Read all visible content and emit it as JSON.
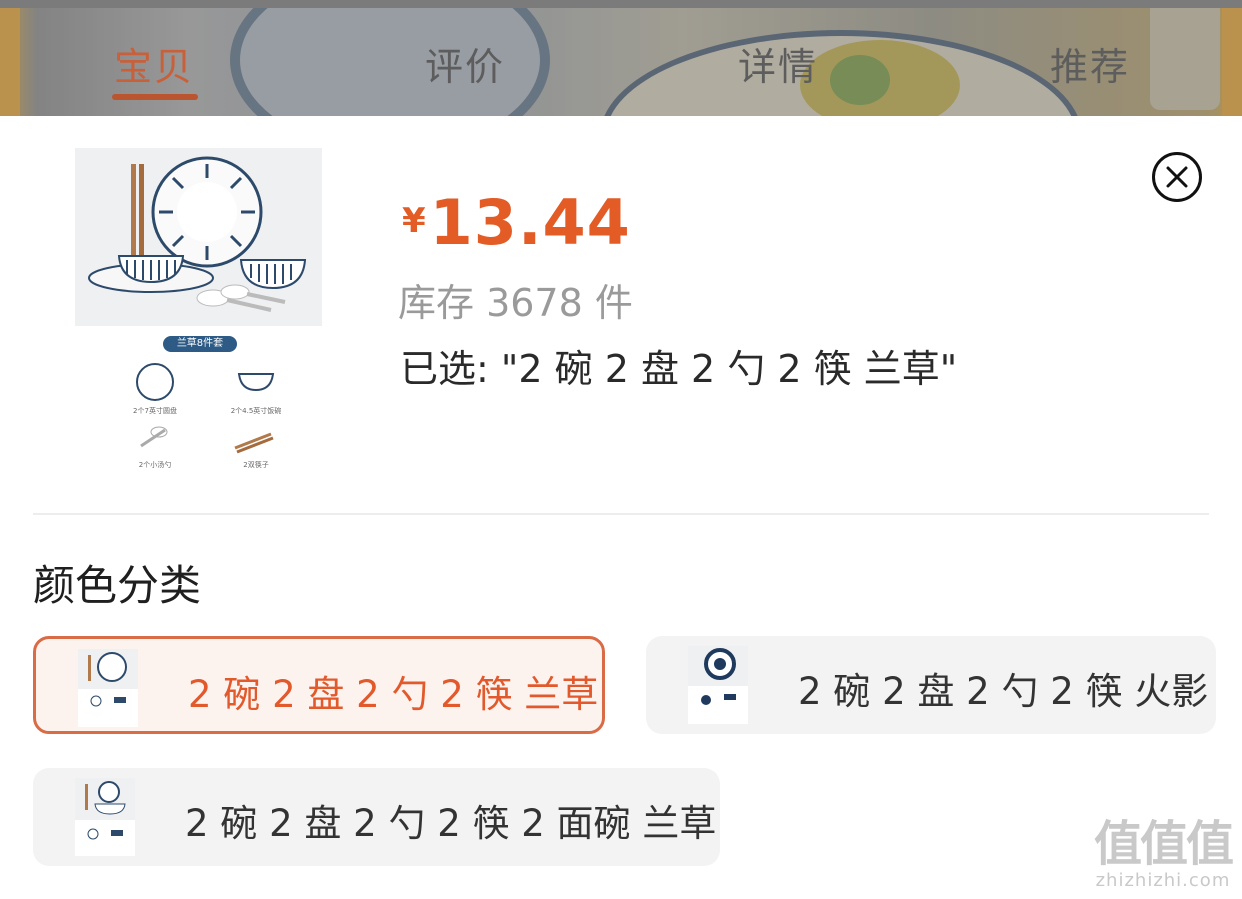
{
  "nav": {
    "tabs": [
      {
        "label": "宝贝",
        "active": true
      },
      {
        "label": "评价",
        "active": false
      },
      {
        "label": "详情",
        "active": false
      },
      {
        "label": "推荐",
        "active": false
      }
    ]
  },
  "product": {
    "currency": "¥",
    "price": "13.44",
    "stock": "库存 3678 件",
    "selected": "已选: \"2 碗 2 盘 2 勺 2 筷 兰草\"",
    "thumb": {
      "badge": "兰草8件套",
      "captions": [
        "2个7英寸圆盘",
        "2个4.5英寸饭碗",
        "2个小汤勺",
        "2双筷子"
      ]
    }
  },
  "section": {
    "title": "颜色分类"
  },
  "options": [
    {
      "label": "2 碗 2 盘 2 勺 2 筷 兰草",
      "selected": true
    },
    {
      "label": "2 碗 2 盘 2 勺 2 筷 火影",
      "selected": false
    },
    {
      "label": "2 碗 2 盘 2 勺 2 筷 2 面碗 兰草",
      "selected": false
    }
  ],
  "close_icon": "close-circle-icon",
  "watermark": {
    "big": "值值值",
    "small": "zhizhizhi.com"
  },
  "colors": {
    "accent": "#e35b25",
    "tab_active": "#c8603a",
    "selected_border": "#d96b47"
  }
}
